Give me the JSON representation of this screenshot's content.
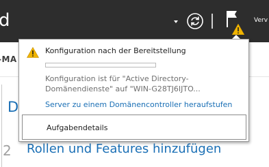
{
  "header": {
    "title": "d",
    "user_label": "Verv",
    "icons": [
      "dropdown-arrow-icon",
      "refresh-icon",
      "flag-icon",
      "warning-icon"
    ],
    "accent_color": "#2d2d2d"
  },
  "subheader": {
    "label": "-MA"
  },
  "background": {
    "partial_heading": "D",
    "step_number": "2",
    "step_label": "Rollen und Features hinzufügen",
    "link_color": "#1a6fb5"
  },
  "notification": {
    "title": "Konfiguration nach der Bereitstellung",
    "progress": 0.0,
    "description_line1": "Konfiguration ist für \"Active Directory-",
    "description_line2": "Domänendienste\" auf \"WIN-G28TJ6IJTO...",
    "action_link": "Server zu einem Domänencontroller heraufstufen",
    "task_details_label": "Aufgabendetails",
    "warning_color": "#f0b400"
  }
}
